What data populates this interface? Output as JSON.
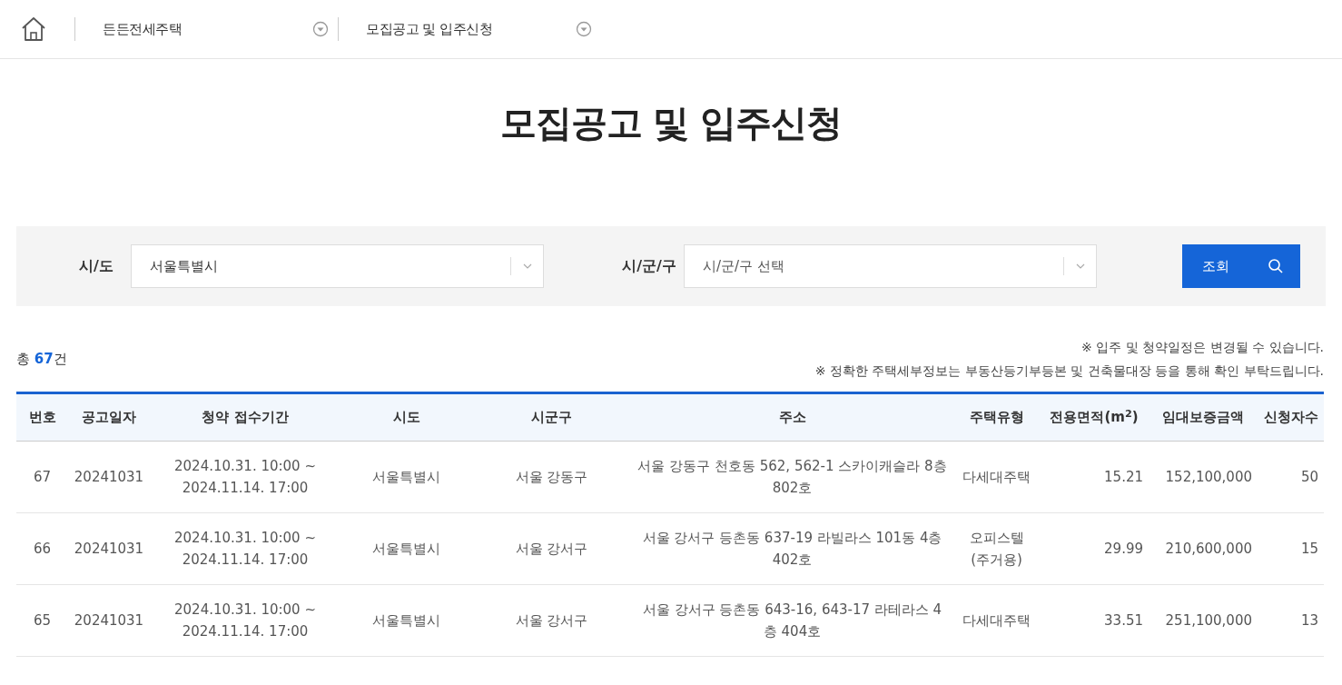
{
  "nav": {
    "crumbs": [
      {
        "label": "든든전세주택"
      },
      {
        "label": "모집공고 및 입주신청"
      }
    ]
  },
  "page_title": "모집공고 및 입주신청",
  "search": {
    "fields": [
      {
        "label": "시/도",
        "value": "서울특별시"
      },
      {
        "label": "시/군/구",
        "placeholder": "시/군/구 선택"
      }
    ],
    "button": "조회"
  },
  "summary": {
    "prefix": "총",
    "count": "67",
    "suffix": "건"
  },
  "notes": [
    "※ 입주 및 청약일정은 변경될 수 있습니다.",
    "※ 정확한 주택세부정보는 부동산등기부등본 및 건축물대장 등을 통해 확인 부탁드립니다."
  ],
  "table": {
    "columns": [
      "번호",
      "공고일자",
      "청약 접수기간",
      "시도",
      "시군구",
      "주소",
      "주택유형",
      "전용면적(m$^{2}$)",
      "임대보증금액",
      "신청자수"
    ],
    "rows": [
      [
        "67",
        "20241031",
        "2024.10.31. 10:00 ~ 2024.11.14. 17:00",
        "서울특별시",
        "서울 강동구",
        "서울 강동구 천호동 562, 562-1 스카이캐슬라 8층 802호",
        "다세대주택",
        "15.21",
        "152,100,000",
        "50"
      ],
      [
        "66",
        "20241031",
        "2024.10.31. 10:00 ~ 2024.11.14. 17:00",
        "서울특별시",
        "서울 강서구",
        "서울 강서구 등촌동 637-19 라빌라스 101동 4층 402호",
        "오피스텔 (주거용)",
        "29.99",
        "210,600,000",
        "15"
      ],
      [
        "65",
        "20241031",
        "2024.10.31. 10:00 ~ 2024.11.14. 17:00",
        "서울특별시",
        "서울 강서구",
        "서울 강서구 등촌동 643-16, 643-17 라테라스 4층 404호",
        "다세대주택",
        "33.51",
        "251,100,000",
        "13"
      ]
    ]
  }
}
